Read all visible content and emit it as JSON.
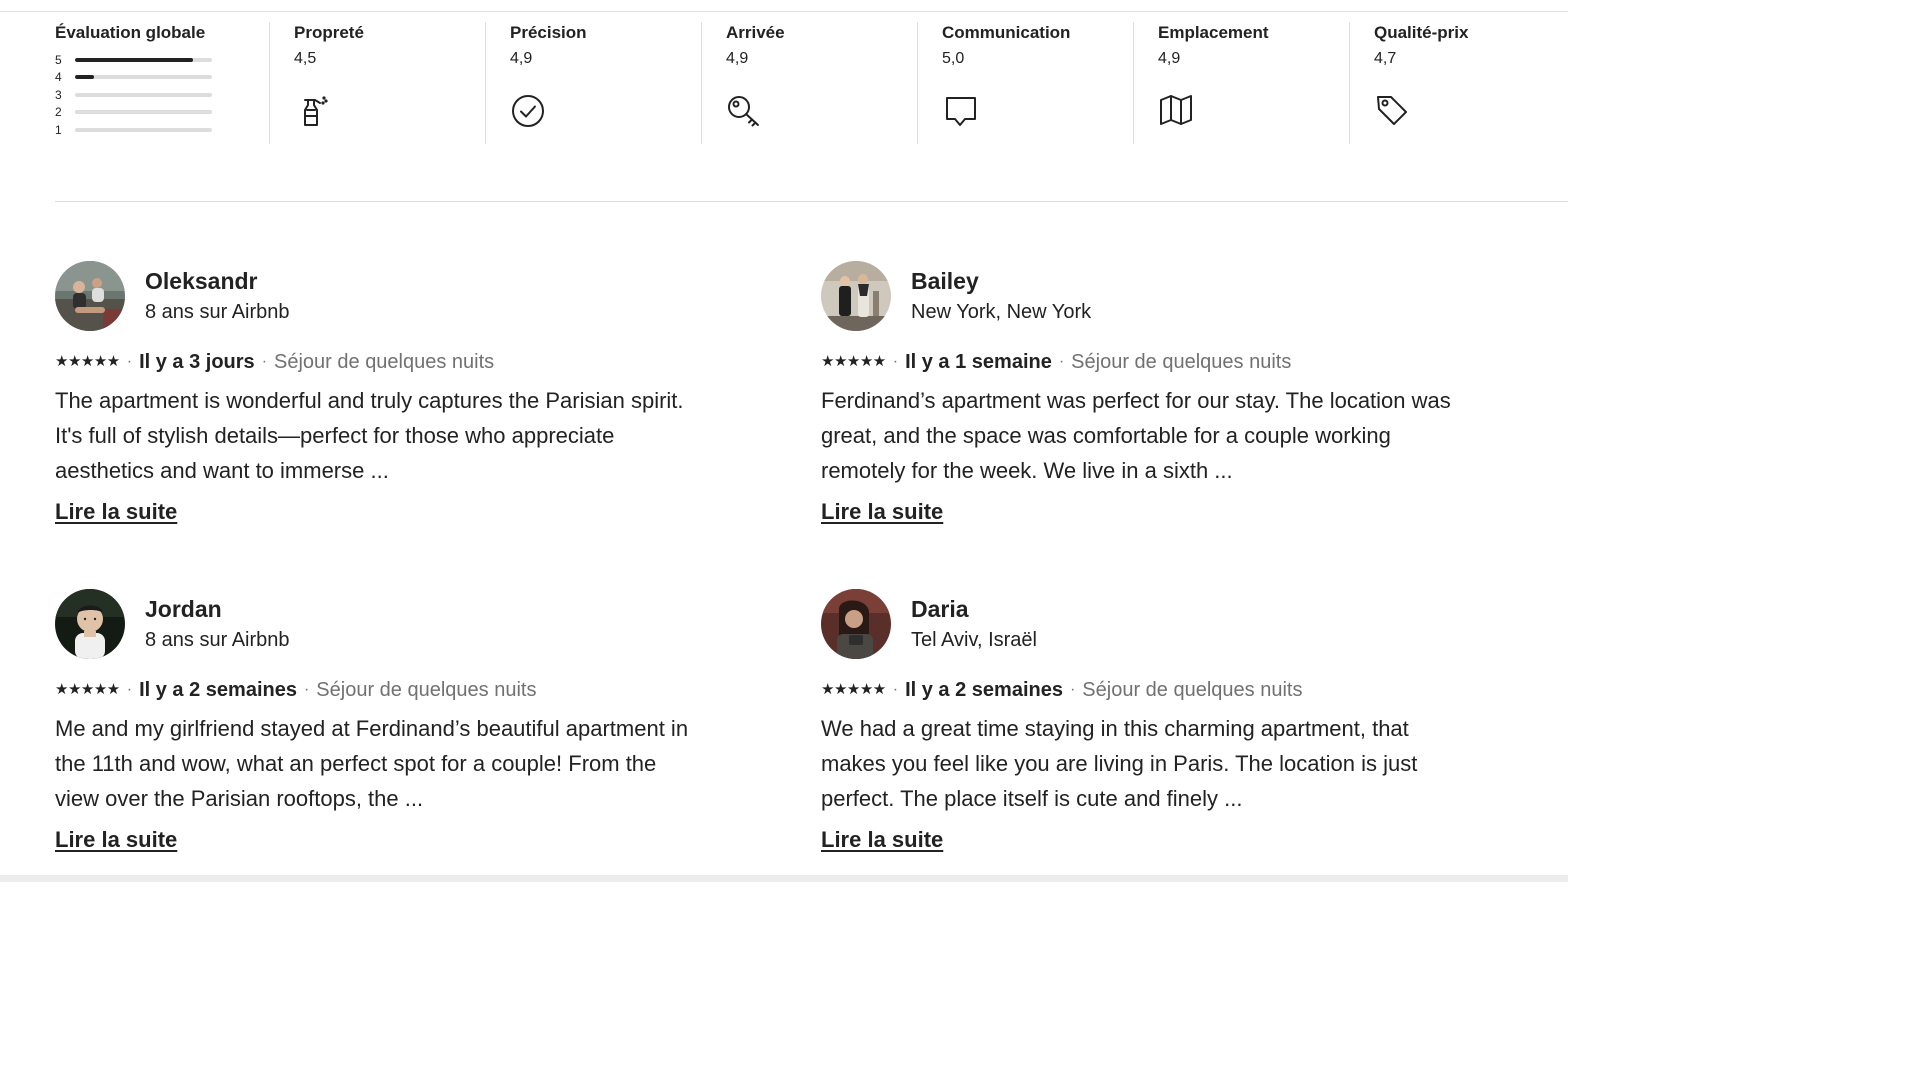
{
  "ratings": {
    "overall": {
      "label": "Évaluation globale",
      "distribution": [
        {
          "stars": "5",
          "fraction": 0.86
        },
        {
          "stars": "4",
          "fraction": 0.14
        },
        {
          "stars": "3",
          "fraction": 0
        },
        {
          "stars": "2",
          "fraction": 0
        },
        {
          "stars": "1",
          "fraction": 0
        }
      ]
    },
    "categories": [
      {
        "label": "Propreté",
        "value": "4,5",
        "icon": "spray-bottle-icon"
      },
      {
        "label": "Précision",
        "value": "4,9",
        "icon": "check-circle-icon"
      },
      {
        "label": "Arrivée",
        "value": "4,9",
        "icon": "key-icon"
      },
      {
        "label": "Communication",
        "value": "5,0",
        "icon": "chat-bubble-icon"
      },
      {
        "label": "Emplacement",
        "value": "4,9",
        "icon": "map-icon"
      },
      {
        "label": "Qualité-prix",
        "value": "4,7",
        "icon": "price-tag-icon"
      }
    ]
  },
  "reviews": [
    {
      "name": "Oleksandr",
      "subtitle": "8 ans sur Airbnb",
      "stars": "★★★★★",
      "when": "Il y a 3 jours",
      "stay": "Séjour de quelques nuits",
      "text": "The apartment is wonderful and truly captures the Parisian spirit. It's full of stylish details—perfect for those who appreciate aesthetics and want to immerse ...",
      "read_more": "Lire la suite"
    },
    {
      "name": "Bailey",
      "subtitle": "New York, New York",
      "stars": "★★★★★",
      "when": "Il y a 1 semaine",
      "stay": "Séjour de quelques nuits",
      "text": "Ferdinand’s apartment was perfect for our stay. The location was great, and the space was comfortable for a couple working remotely for the week. We live in a sixth ...",
      "read_more": "Lire la suite"
    },
    {
      "name": "Jordan",
      "subtitle": "8 ans sur Airbnb",
      "stars": "★★★★★",
      "when": "Il y a 2 semaines",
      "stay": "Séjour de quelques nuits",
      "text": "Me and my girlfriend stayed at Ferdinand’s beautiful apartment in the 11th and wow, what an perfect spot for a couple! From the view over the Parisian rooftops, the ...",
      "read_more": "Lire la suite"
    },
    {
      "name": "Daria",
      "subtitle": "Tel Aviv, Israël",
      "stars": "★★★★★",
      "when": "Il y a 2 semaines",
      "stay": "Séjour de quelques nuits",
      "text": "We had a great time staying in this charming apartment, that makes you feel like you are living in Paris. The location is just perfect. The place itself is cute and finely ...",
      "read_more": "Lire la suite"
    }
  ]
}
